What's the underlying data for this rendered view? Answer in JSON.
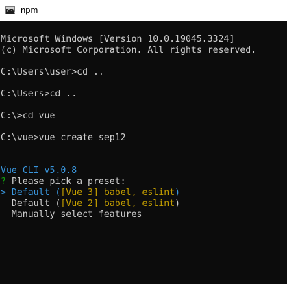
{
  "window": {
    "title": "npm",
    "icon": "terminal-icon"
  },
  "console": {
    "header": [
      "Microsoft Windows [Version 10.0.19045.3324]",
      "(c) Microsoft Corporation. All rights reserved."
    ],
    "commands": [
      "C:\\Users\\user>cd ..",
      "C:\\Users>cd ..",
      "C:\\>cd vue",
      "C:\\vue>vue create sep12"
    ],
    "cli_version": "Vue CLI v5.0.8",
    "prompt": {
      "marker": "?",
      "text": " Please pick a preset:"
    },
    "options": [
      {
        "pointer": "> ",
        "name": "Default (",
        "detail": "[Vue 3] babel, eslint",
        "close": ")"
      },
      {
        "pointer": "  ",
        "name": "Default (",
        "detail": "[Vue 2] babel, eslint",
        "close": ")"
      },
      {
        "pointer": "  ",
        "name": "Manually select features"
      }
    ]
  },
  "colors": {
    "background": "#0c0c0c",
    "text": "#cccccc",
    "selected": "#3a96dd",
    "prompt_marker": "#13a10e",
    "preset_detail": "#c19c00"
  }
}
